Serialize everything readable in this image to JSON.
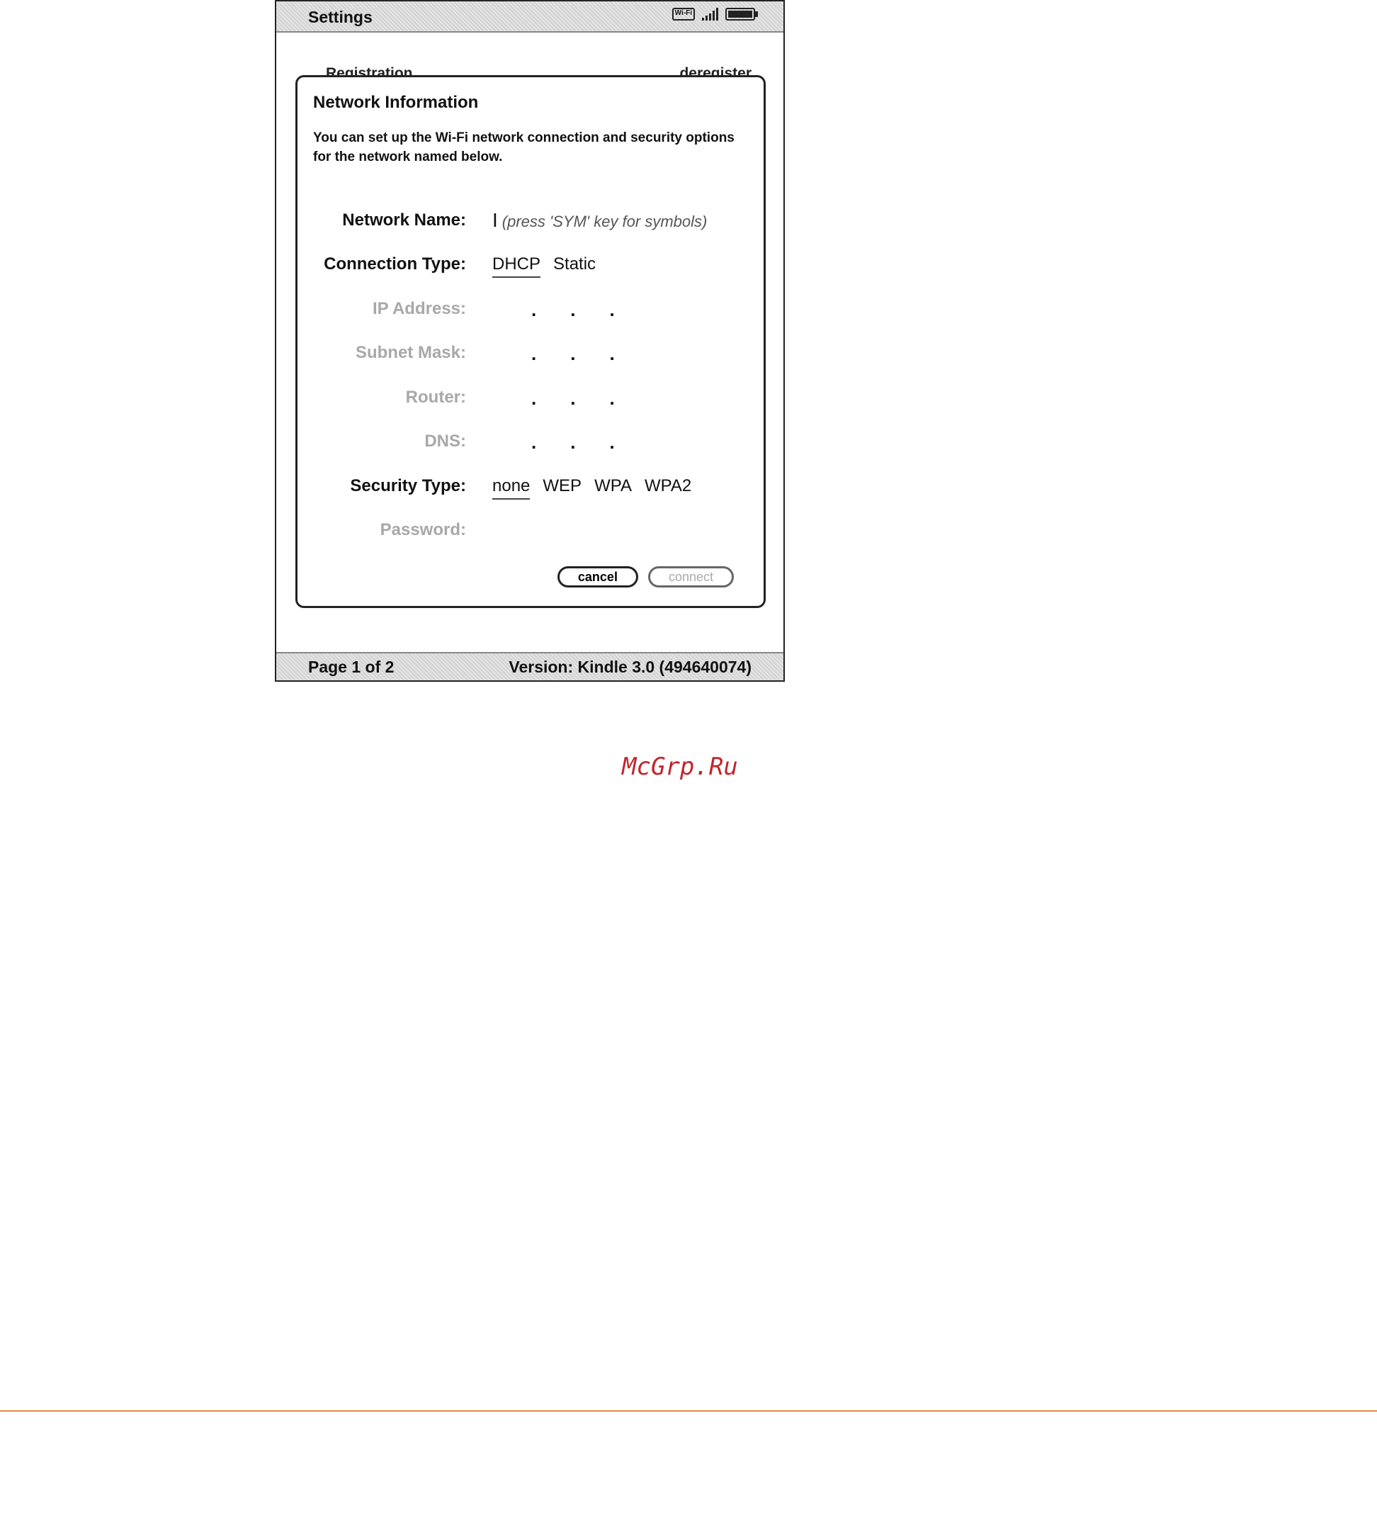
{
  "header": {
    "title": "Settings",
    "wifi_badge": "Wi-Fi"
  },
  "background_row": {
    "left": "Registration",
    "right": "deregister"
  },
  "dialog": {
    "title": "Network Information",
    "description": "You can set up the Wi-Fi network connection and security options for the network named below.",
    "fields": {
      "network_name": {
        "label": "Network Name:",
        "placeholder": "(press 'SYM' key for symbols)"
      },
      "connection_type": {
        "label": "Connection Type:",
        "options": [
          "DHCP",
          "Static"
        ],
        "selected": "DHCP"
      },
      "ip_address": {
        "label": "IP Address:"
      },
      "subnet_mask": {
        "label": "Subnet Mask:"
      },
      "router": {
        "label": "Router:"
      },
      "dns": {
        "label": "DNS:"
      },
      "security_type": {
        "label": "Security Type:",
        "options": [
          "none",
          "WEP",
          "WPA",
          "WPA2"
        ],
        "selected": "none"
      },
      "password": {
        "label": "Password:"
      }
    },
    "buttons": {
      "cancel": "cancel",
      "connect": "connect"
    }
  },
  "footer": {
    "page": "Page 1 of 2",
    "version": "Version: Kindle 3.0 (494640074)"
  },
  "watermark": "McGrp.Ru",
  "colors": {
    "watermark": "#c0262d",
    "divider": "#e88a3c"
  },
  "icons": [
    "wifi-icon",
    "signal-strength-icon",
    "battery-icon",
    "text-cursor-icon"
  ]
}
